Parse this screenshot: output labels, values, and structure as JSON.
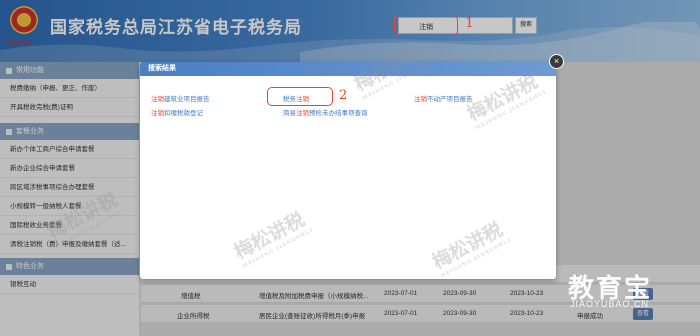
{
  "header": {
    "emblem_text": "中国税务",
    "title": "国家税务总局江苏省电子税务局",
    "search_value": "注销",
    "search_button": "搜索",
    "annotation_1": "1"
  },
  "sidebar": {
    "sections": [
      {
        "title": "常用功能"
      },
      {
        "title": "套餐业务"
      },
      {
        "title": "特色业务"
      }
    ],
    "common_items": [
      "税费缴纳（申报、更正、作废）",
      "开具税收完税(费)证明"
    ],
    "package_items": [
      "新办个体工商户综合申请套餐",
      "新办企业综合申请套餐",
      "跨区域涉税事项综合办理套餐",
      "小规模转一般纳税人套餐",
      "国际税收业务套餐",
      "清税注销税（费）申报及缴纳套餐（适..."
    ],
    "special_items": [
      "银税互动"
    ]
  },
  "modal": {
    "title": "搜索结果",
    "close_glyph": "×",
    "annotation_2": "2",
    "results": [
      {
        "keyword": "注销",
        "rest": "建筑业项目报告"
      },
      {
        "keyword": "注销",
        "rest": "扣缴税款登记"
      },
      {
        "prefix": "税务",
        "keyword": "注销",
        "rest": ""
      },
      {
        "prefix": "简易",
        "keyword": "注销",
        "rest": "预检未办结事项查询"
      },
      {
        "keyword": "注销",
        "rest": "不动产项目报告"
      }
    ]
  },
  "table": {
    "rows": [
      [
        "增值税",
        "增值税及附加税费申报（小规模纳税...",
        "2023-07-01",
        "2023-09-30",
        "2023-10-23",
        "",
        "查看"
      ],
      [
        "企业所得税",
        "居民企业(查账征收)所得税月(季)申报",
        "2023-07-01",
        "2023-09-30",
        "2023-10-23",
        "申报成功",
        "查看"
      ]
    ]
  },
  "watermarks": {
    "text": "梅松讲税",
    "sub": "MEISONG JIANGSHUI",
    "brand": "教育宝",
    "brand_url": "JIAOYUBAO.CN"
  }
}
